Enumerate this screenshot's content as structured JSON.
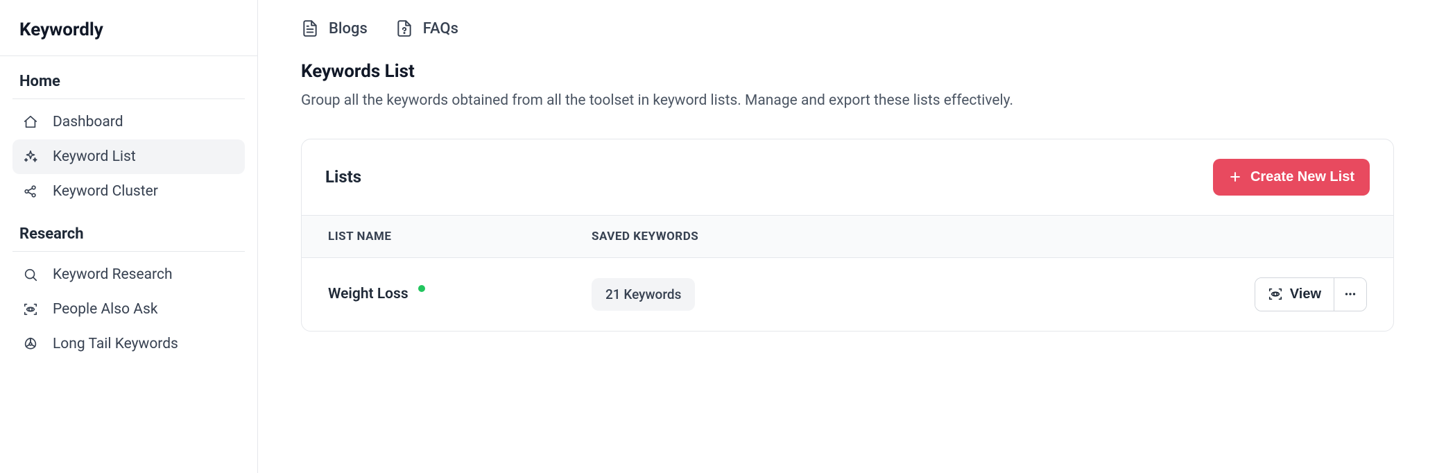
{
  "brand": {
    "name": "Keywordly"
  },
  "sidebar": {
    "sections": [
      {
        "title": "Home",
        "items": [
          {
            "label": "Dashboard",
            "icon": "home-icon",
            "active": false
          },
          {
            "label": "Keyword List",
            "icon": "sparkles-icon",
            "active": true
          },
          {
            "label": "Keyword Cluster",
            "icon": "share-icon",
            "active": false
          }
        ]
      },
      {
        "title": "Research",
        "items": [
          {
            "label": "Keyword Research",
            "icon": "search-icon",
            "active": false
          },
          {
            "label": "People Also Ask",
            "icon": "scan-eye-icon",
            "active": false
          },
          {
            "label": "Long Tail Keywords",
            "icon": "radioactive-icon",
            "active": false
          }
        ]
      }
    ]
  },
  "topbar": {
    "items": [
      {
        "label": "Blogs",
        "icon": "file-text-icon"
      },
      {
        "label": "FAQs",
        "icon": "file-question-icon"
      }
    ]
  },
  "page": {
    "title": "Keywords List",
    "subtitle": "Group all the keywords obtained from all the toolset in keyword lists. Manage and export these lists effectively."
  },
  "card": {
    "title": "Lists",
    "create_label": "Create New List",
    "columns": {
      "name": "LIST NAME",
      "saved": "SAVED KEYWORDS"
    },
    "rows": [
      {
        "name": "Weight Loss",
        "status_color": "#22c55e",
        "saved": "21 Keywords",
        "view_label": "View"
      }
    ]
  }
}
